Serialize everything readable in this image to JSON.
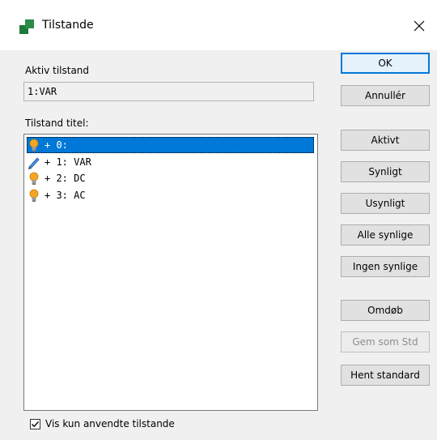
{
  "window": {
    "title": "Tilstande",
    "close_glyph": "✕"
  },
  "active_state": {
    "label": "Aktiv tilstand",
    "value": "1:VAR"
  },
  "state_list": {
    "label": "Tilstand titel:",
    "items": [
      {
        "icon": "lightbulb-icon",
        "text": "+ 0:",
        "selected": true
      },
      {
        "icon": "pencil-icon",
        "text": "+ 1: VAR",
        "selected": false
      },
      {
        "icon": "lightbulb-icon",
        "text": "+ 2: DC",
        "selected": false
      },
      {
        "icon": "lightbulb-icon",
        "text": "+ 3: AC",
        "selected": false
      }
    ]
  },
  "buttons": {
    "ok": "OK",
    "cancel": "Annullér",
    "active": "Aktivt",
    "visible": "Synligt",
    "invisible": "Usynligt",
    "all_visible": "Alle synlige",
    "none_visible": "Ingen synlige",
    "rename": "Omdøb",
    "save_default": "Gem som Std",
    "load_default": "Hent standard"
  },
  "options": {
    "show_used_only_label": "Vis kun anvendte tilstande",
    "show_used_only_checked": true
  },
  "colors": {
    "selection": "#0078d7",
    "bulb": "#f5a623"
  }
}
